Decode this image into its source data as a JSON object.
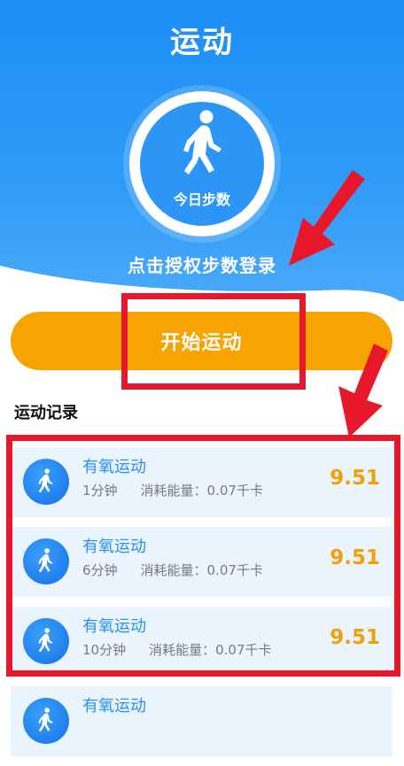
{
  "header": {
    "title": "运动"
  },
  "steps": {
    "label": "今日步数",
    "auth_prompt": "点击授权步数登录"
  },
  "actions": {
    "start_label": "开始运动"
  },
  "records": {
    "section_title": "运动记录",
    "items": [
      {
        "name": "有氧运动",
        "duration": "1分钟",
        "energy": "消耗能量：0.07千卡",
        "value": "9.51"
      },
      {
        "name": "有氧运动",
        "duration": "6分钟",
        "energy": "消耗能量：0.07千卡",
        "value": "9.51"
      },
      {
        "name": "有氧运动",
        "duration": "10分钟",
        "energy": "消耗能量：0.07千卡",
        "value": "9.51"
      },
      {
        "name": "有氧运动",
        "duration": "",
        "energy": "",
        "value": ""
      }
    ]
  },
  "colors": {
    "primary": "#2c95f6",
    "accent": "#f7a300",
    "highlight": "#e8182c",
    "record_bg": "#eaf4fd"
  },
  "icons": {
    "walker": "walking-person-icon"
  }
}
